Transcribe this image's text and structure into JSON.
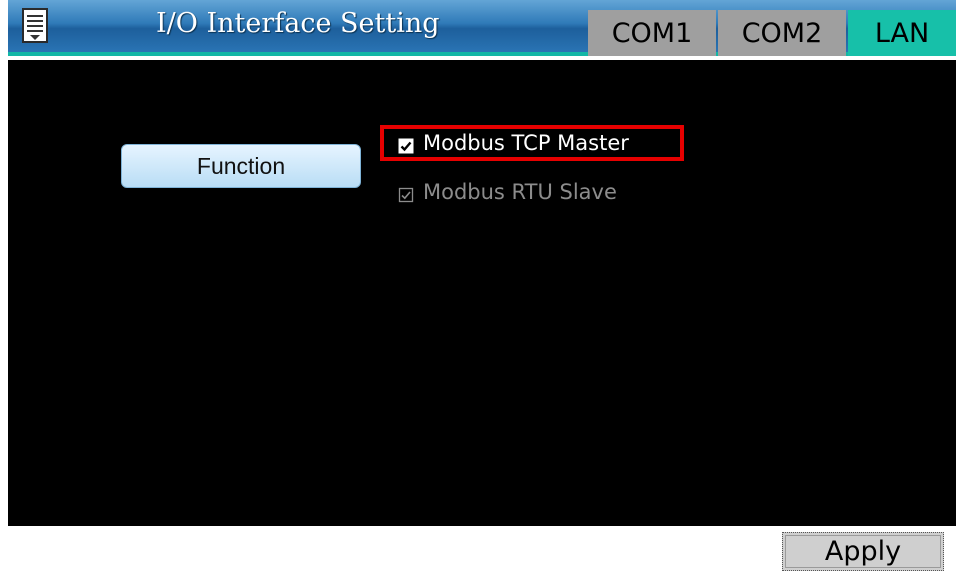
{
  "header": {
    "menu_icon": "list-menu-icon",
    "title": "I/O Interface Setting",
    "tabs": [
      {
        "label": "COM1",
        "active": false
      },
      {
        "label": "COM2",
        "active": false
      },
      {
        "label": "LAN",
        "active": true
      }
    ]
  },
  "main": {
    "function_button": "Function",
    "options": [
      {
        "label": "Modbus TCP Master",
        "checked": true,
        "enabled": true,
        "highlighted": true
      },
      {
        "label": "Modbus RTU Slave",
        "checked": true,
        "enabled": false,
        "highlighted": false
      }
    ]
  },
  "footer": {
    "apply_label": "Apply"
  },
  "colors": {
    "header_blue": "#2f7ab8",
    "active_tab": "#17c0a9",
    "inactive_tab": "#9f9f9f",
    "highlight": "#e60000",
    "background": "#000000"
  }
}
